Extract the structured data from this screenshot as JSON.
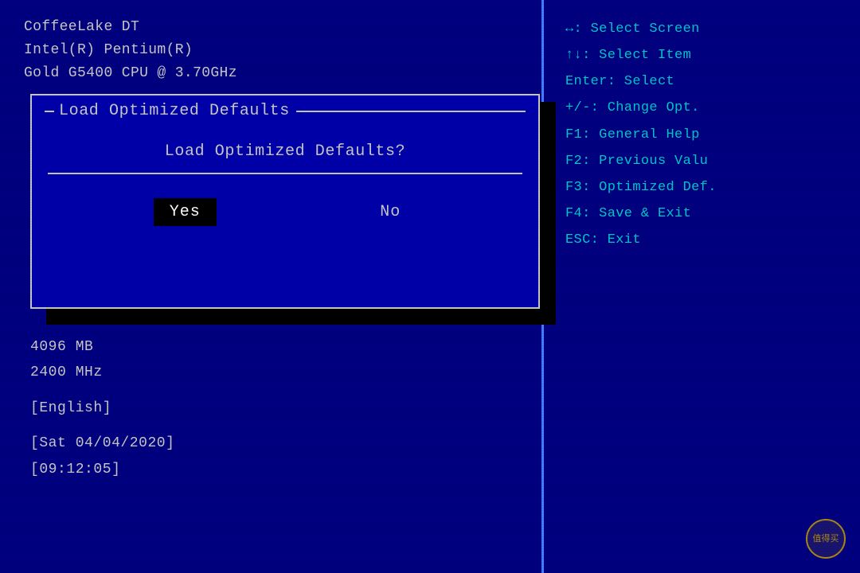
{
  "bios": {
    "cpu": {
      "line1": "CoffeeLake DT",
      "line2": "Intel(R) Pentium(R)",
      "line3": "Gold G5400 CPU @ 3.70GHz"
    },
    "dialog": {
      "title": "Load Optimized Defaults",
      "question": "Load Optimized Defaults?",
      "yes_label": "Yes",
      "no_label": "No"
    },
    "sysinfo": {
      "mem": "4096 MB",
      "freq": "2400 MHz",
      "lang": "[English]",
      "date": "[Sat 04/04/2020]",
      "time": "[09:12:05]"
    },
    "help": {
      "line1": "↔: Select Screen",
      "line2": "↑↓: Select Item",
      "line3": "Enter: Select",
      "line4": "+/-: Change Opt.",
      "line5": "F1: General Help",
      "line6": "F2: Previous Valu",
      "line7": "F3: Optimized Def.",
      "line8": "F4: Save & Exit",
      "line9": "ESC: Exit"
    },
    "watermark": "值得买"
  }
}
